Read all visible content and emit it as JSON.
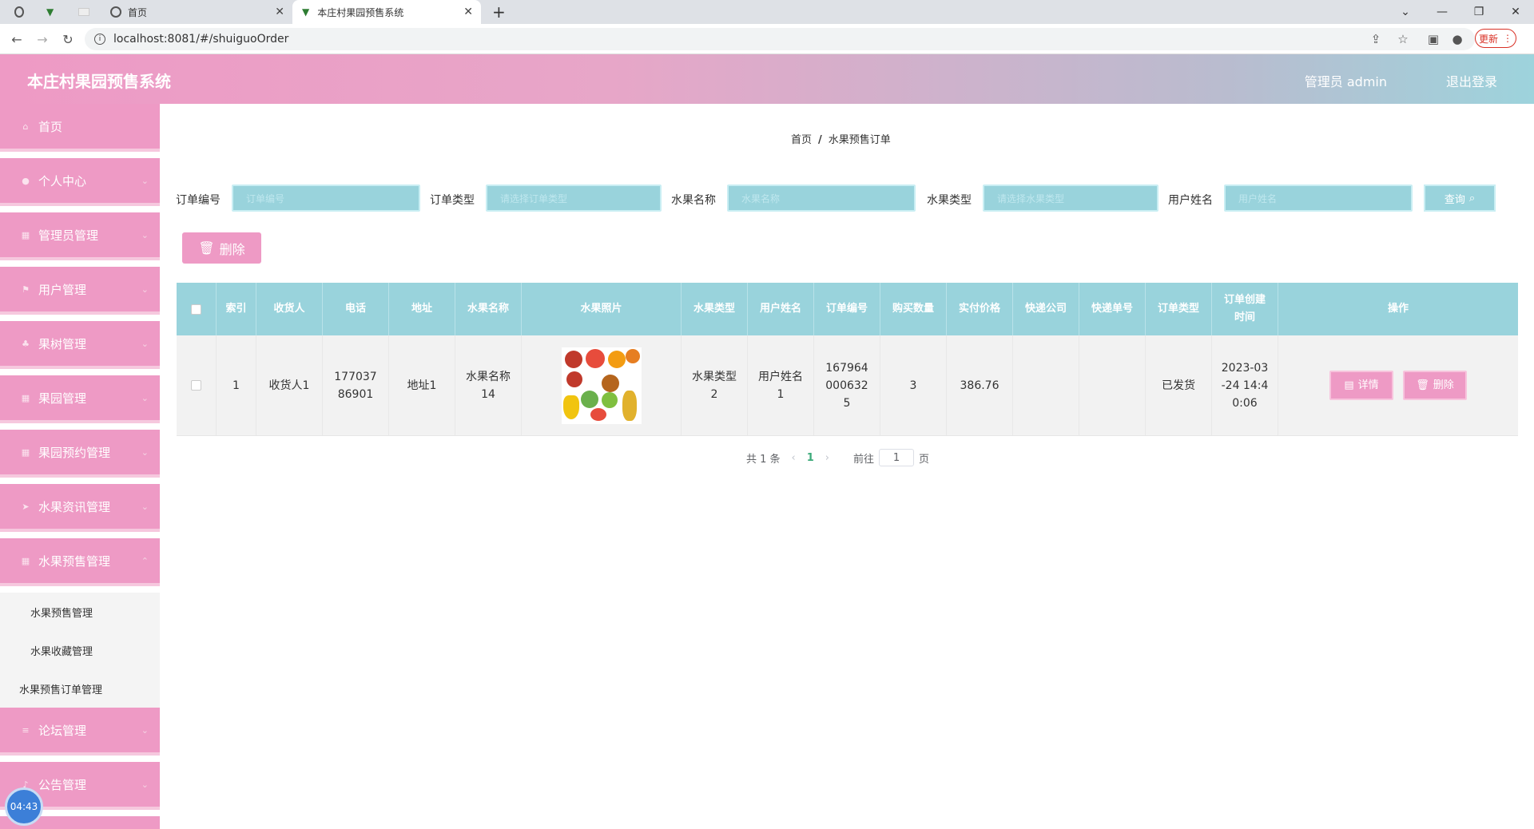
{
  "browser": {
    "tabs": [
      {
        "label": "首页"
      },
      {
        "label": "本庄村果园预售系统"
      }
    ],
    "url": "localhost:8081/#/shuiguoOrder",
    "update_label": "更新"
  },
  "header": {
    "title": "本庄村果园预售系统",
    "admin_label": "管理员 admin",
    "logout_label": "退出登录"
  },
  "sidebar": {
    "items": [
      {
        "label": "首页"
      },
      {
        "label": "个人中心"
      },
      {
        "label": "管理员管理"
      },
      {
        "label": "用户管理"
      },
      {
        "label": "果树管理"
      },
      {
        "label": "果园管理"
      },
      {
        "label": "果园预约管理"
      },
      {
        "label": "水果资讯管理"
      },
      {
        "label": "水果预售管理"
      },
      {
        "label": "论坛管理"
      },
      {
        "label": "公告管理"
      }
    ],
    "submenu": [
      {
        "label": "水果预售管理"
      },
      {
        "label": "水果收藏管理"
      },
      {
        "label": "水果预售订单管理"
      }
    ],
    "timer": "04:43"
  },
  "breadcrumb": {
    "home": "首页",
    "sep": "/",
    "current": "水果预售订单"
  },
  "search": {
    "fields": [
      {
        "label": "订单编号",
        "placeholder": "订单编号"
      },
      {
        "label": "订单类型",
        "placeholder": "请选择订单类型"
      },
      {
        "label": "水果名称",
        "placeholder": "水果名称"
      },
      {
        "label": "水果类型",
        "placeholder": "请选择水果类型"
      },
      {
        "label": "用户姓名",
        "placeholder": "用户姓名"
      }
    ],
    "query_label": "查询"
  },
  "toolbar": {
    "delete_label": "删除"
  },
  "table": {
    "columns": [
      "索引",
      "收货人",
      "电话",
      "地址",
      "水果名称",
      "水果照片",
      "水果类型",
      "用户姓名",
      "订单编号",
      "购买数量",
      "实付价格",
      "快递公司",
      "快递单号",
      "订单类型",
      "订单创建时间",
      "操作"
    ],
    "rows": [
      {
        "index": "1",
        "receiver": "收货人1",
        "phone": "17703786901",
        "address": "地址1",
        "fruit_name": "水果名称14",
        "fruit_type": "水果类型2",
        "user_name": "用户姓名1",
        "order_no": "1679640006325",
        "quantity": "3",
        "price": "386.76",
        "express_company": "",
        "express_no": "",
        "order_type": "已发货",
        "created": "2023-03-24 14:40:06",
        "detail_label": "详情",
        "delete_label": "删除"
      }
    ]
  },
  "pagination": {
    "total": "共 1 条",
    "current_page": "1",
    "goto_label": "前往",
    "goto_value": "1",
    "page_suffix": "页"
  },
  "colors": {
    "pink": "#ee9ac5",
    "teal": "#99d3dc"
  }
}
